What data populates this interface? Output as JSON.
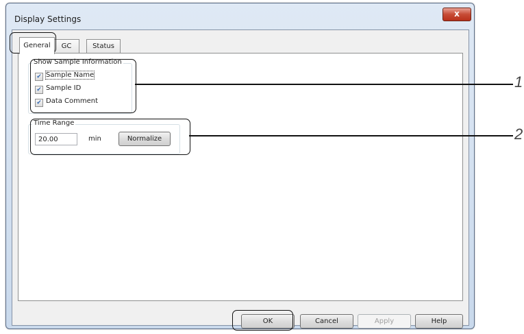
{
  "window": {
    "title": "Display Settings",
    "close_glyph": "x"
  },
  "tabs": [
    {
      "label": "General",
      "selected": true
    },
    {
      "label": "GC",
      "selected": false
    },
    {
      "label": "Status",
      "selected": false
    }
  ],
  "sample_info": {
    "group_label": "Show Sample Information",
    "checkboxes": [
      {
        "label": "Sample Name",
        "checked": true
      },
      {
        "label": "Sample ID",
        "checked": true
      },
      {
        "label": "Data Comment",
        "checked": true
      }
    ]
  },
  "time_range": {
    "group_label": "Time Range",
    "value": "20.00",
    "unit": "min",
    "normalize_label": "Normalize"
  },
  "buttons": {
    "ok": "OK",
    "cancel": "Cancel",
    "apply": "Apply",
    "help": "Help"
  },
  "callouts": {
    "one": "1",
    "two": "2"
  }
}
